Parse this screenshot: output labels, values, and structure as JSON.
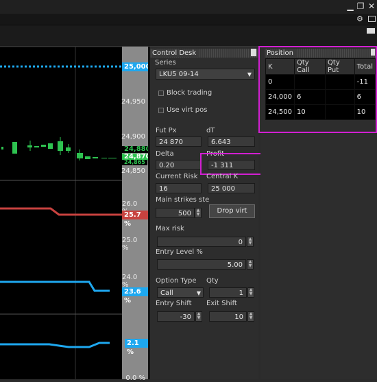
{
  "window": {
    "icons": [
      "minimize-icon",
      "restore-icon",
      "close-icon"
    ]
  },
  "chart": {
    "price_ticks": [
      "24,950",
      "24,900",
      "24,850"
    ],
    "price_tags": [
      {
        "label": "25,000",
        "color": "#1ea8f0"
      },
      {
        "label": "24,880",
        "color": "#2ec250"
      },
      {
        "label": "24,870",
        "color": "#2ec250"
      },
      {
        "label": "24,865",
        "color": "#2ec250"
      }
    ],
    "pct_ticks": [
      "26.0 %",
      "25.0 %",
      "24.0 %",
      "0.0 %"
    ],
    "pct_tags": [
      {
        "label": "25.7 %",
        "color": "#c8423f"
      },
      {
        "label": "23.6 %",
        "color": "#1ea8f0"
      },
      {
        "label": "2.1 %",
        "color": "#1ea8f0"
      }
    ]
  },
  "control_desk": {
    "title": "Control Desk",
    "series_label": "Series",
    "series_value": "LKU5 09-14",
    "block_trading": "Block trading",
    "use_virt_pos": "Use virt pos",
    "fut_px_label": "Fut Px",
    "fut_px": "24 870",
    "dt_label": "dT",
    "dt": "6.643",
    "delta_label": "Delta",
    "delta": "0.20",
    "profit_label": "Profit",
    "profit": "-1 311",
    "current_risk_label": "Current Risk",
    "current_risk": "16",
    "central_k_label": "Central K",
    "central_k": "25 000",
    "main_strikes_label": "Main strikes ste",
    "main_strikes": "500",
    "drop_virt": "Drop virt",
    "max_risk_label": "Max risk",
    "max_risk": "0",
    "entry_level_label": "Entry Level %",
    "entry_level": "5.00",
    "option_type_label": "Option Type",
    "option_type": "Call",
    "qty_label": "Qty",
    "qty": "1",
    "entry_shift_label": "Entry Shift",
    "entry_shift": "-30",
    "exit_shift_label": "Exit Shift",
    "exit_shift": "10"
  },
  "position": {
    "title": "Position",
    "columns": [
      "K",
      "Qty Call",
      "Qty Put",
      "Total"
    ],
    "rows": [
      [
        "0",
        "",
        "",
        "-11"
      ],
      [
        "24,000",
        "6",
        "",
        "6"
      ],
      [
        "24,500",
        "10",
        "",
        "10"
      ]
    ]
  },
  "colors": {
    "highlight": "#d21fd2",
    "accent_blue": "#1ea8f0",
    "accent_red": "#c8423f",
    "accent_green": "#2ec250"
  }
}
